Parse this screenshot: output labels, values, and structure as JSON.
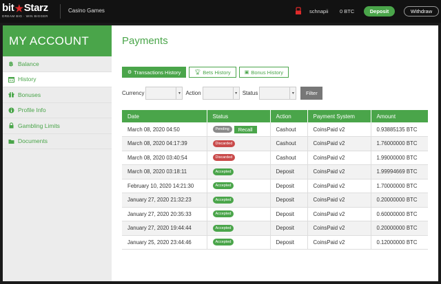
{
  "topbar": {
    "logo_text_a": "bit",
    "logo_text_b": "Starz",
    "logo_tagline": "DREAM BIG · WIN BIGGER",
    "casino_games": "Casino Games",
    "username": "schnapii",
    "balance": "0 BTC",
    "deposit_label": "Deposit",
    "withdraw_label": "Withdraw"
  },
  "sidebar": {
    "title": "MY ACCOUNT",
    "items": [
      {
        "label": "Balance",
        "icon": "bitcoin-icon"
      },
      {
        "label": "History",
        "icon": "calendar-icon"
      },
      {
        "label": "Bonuses",
        "icon": "gift-icon"
      },
      {
        "label": "Profile Info",
        "icon": "info-icon"
      },
      {
        "label": "Gambling Limits",
        "icon": "lock-icon"
      },
      {
        "label": "Documents",
        "icon": "folder-icon"
      }
    ],
    "active_index": 1
  },
  "main": {
    "title": "Payments",
    "tabs": [
      {
        "label": "Transactions History",
        "active": true
      },
      {
        "label": "Bets History",
        "active": false
      },
      {
        "label": "Bonus History",
        "active": false
      }
    ],
    "filters": {
      "currency_label": "Currency",
      "action_label": "Action",
      "status_label": "Status",
      "filter_button": "Filter"
    },
    "table": {
      "headers": [
        "Date",
        "Status",
        "Action",
        "Payment System",
        "Amount"
      ],
      "recall_label": "Recall",
      "rows": [
        {
          "date": "March 08, 2020 04:50",
          "status": "Pending",
          "action": "Cashout",
          "system": "CoinsPaid v2",
          "amount": "0.93885135 BTC"
        },
        {
          "date": "March 08, 2020 04:17:39",
          "status": "Discarded",
          "action": "Cashout",
          "system": "CoinsPaid v2",
          "amount": "1.76000000 BTC"
        },
        {
          "date": "March 08, 2020 03:40:54",
          "status": "Discarded",
          "action": "Cashout",
          "system": "CoinsPaid v2",
          "amount": "1.99000000 BTC"
        },
        {
          "date": "March 08, 2020 03:18:11",
          "status": "Accepted",
          "action": "Deposit",
          "system": "CoinsPaid v2",
          "amount": "1.99994669 BTC"
        },
        {
          "date": "February 10, 2020 14:21:30",
          "status": "Accepted",
          "action": "Deposit",
          "system": "CoinsPaid v2",
          "amount": "1.70000000 BTC"
        },
        {
          "date": "January 27, 2020 21:32:23",
          "status": "Accepted",
          "action": "Deposit",
          "system": "CoinsPaid v2",
          "amount": "0.20000000 BTC"
        },
        {
          "date": "January 27, 2020 20:35:33",
          "status": "Accepted",
          "action": "Deposit",
          "system": "CoinsPaid v2",
          "amount": "0.60000000 BTC"
        },
        {
          "date": "January 27, 2020 19:44:44",
          "status": "Accepted",
          "action": "Deposit",
          "system": "CoinsPaid v2",
          "amount": "0.20000000 BTC"
        },
        {
          "date": "January 25, 2020 23:44:46",
          "status": "Accepted",
          "action": "Deposit",
          "system": "CoinsPaid v2",
          "amount": "0.12000000 BTC"
        }
      ]
    }
  },
  "colors": {
    "brand_green": "#4aa54a",
    "discarded_red": "#c94a4a",
    "pending_gray": "#8a8a8a",
    "logo_red": "#e02a2a"
  }
}
